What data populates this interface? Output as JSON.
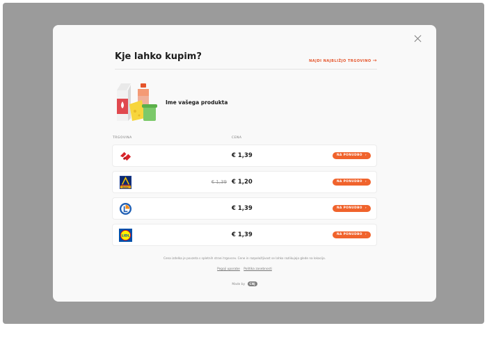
{
  "modal": {
    "title": "Kje lahko kupim?",
    "nearest_store_link": "NAJDI NAJBLIŽJO TRGOVINO",
    "close_icon": "close-icon"
  },
  "product": {
    "name": "Ime vašega produkta",
    "image_icon": "product-illustration"
  },
  "table": {
    "headers": {
      "store": "TRGOVINA",
      "price": "CENA"
    },
    "rows": [
      {
        "store_logo": "spar-logo",
        "old_price": "",
        "price": "€ 1,39",
        "button": "NA PONUDBO"
      },
      {
        "store_logo": "hofer-logo",
        "old_price": "€ 1,39",
        "price": "€ 1,20",
        "button": "NA PONUDBO"
      },
      {
        "store_logo": "leclerc-logo",
        "old_price": "",
        "price": "€ 1,39",
        "button": "NA PONUDBO"
      },
      {
        "store_logo": "lidl-logo",
        "old_price": "",
        "price": "€ 1,39",
        "button": "NA PONUDBO"
      }
    ]
  },
  "footer": {
    "disclaimer": "Cena izdelka je povzeta s spletnih strani trgovcev. Cene in razpoložljivost se lahko razlikujejo glede na lokacijo.",
    "terms": "Pogoji uporabe",
    "privacy": "Politika zasebnosti",
    "made_by": "Made by",
    "made_by_badge": "CNJ"
  },
  "colors": {
    "accent": "#f0632c",
    "overlay": "#9b9b9b",
    "modal_bg": "#f9f9f9"
  }
}
